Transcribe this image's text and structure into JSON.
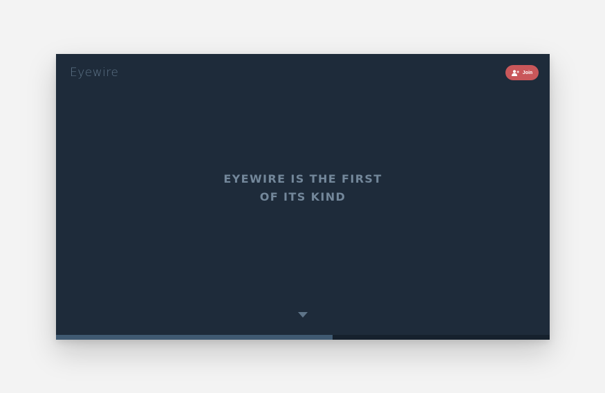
{
  "header": {
    "logo_text": "Eyewire",
    "join_label": "Join"
  },
  "hero": {
    "line1": "EYEWIRE IS THE FIRST",
    "line2": "OF ITS KIND"
  },
  "progress": {
    "fraction": 0.56
  },
  "icons": {
    "join": "add-user-icon",
    "scroll": "chevron-down-icon"
  },
  "colors": {
    "background": "#1e2b3a",
    "join_button": "#c9575a",
    "hero_text": "#73879a",
    "logo": "#5e7488",
    "progress_fill": "#405a72",
    "progress_track": "#16212d"
  }
}
